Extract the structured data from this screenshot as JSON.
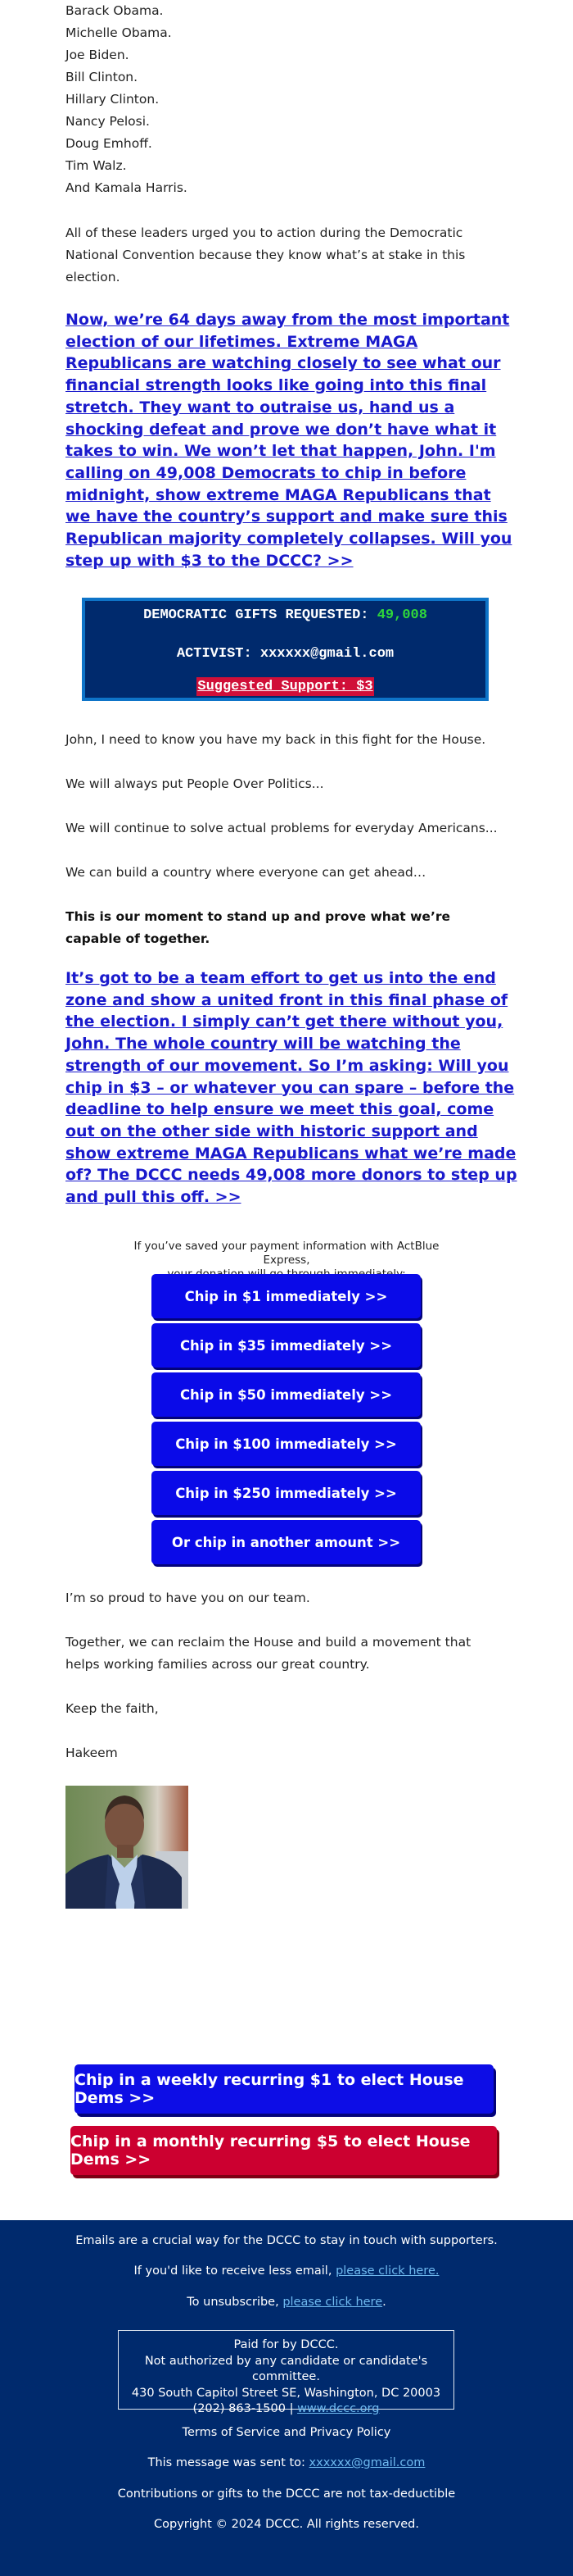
{
  "leaders": [
    "Barack Obama.",
    "Michelle Obama.",
    "Joe Biden.",
    "Bill Clinton.",
    "Hillary Clinton.",
    "Nancy Pelosi.",
    "Doug Emhoff.",
    "Tim Walz.",
    "And Kamala Harris."
  ],
  "intro_paragraph": "All of these leaders urged you to action during the Democratic National Convention because they know what’s at stake in this election.",
  "cta_link_1": "Now, we’re 64 days away from the most important election of our lifetimes. Extreme MAGA Republicans are watching closely to see what our financial strength looks like going into this final stretch. They want to outraise us, hand us a shocking defeat and prove we don’t have what it takes to win. We won’t let that happen, John. I'm calling on 49,008 Democrats to chip in before midnight, show extreme MAGA Republicans that we have the country’s support and make sure this Republican majority completely collapses. Will you step up with $3 to the DCCC? >>",
  "gift_box": {
    "requested_label": "DEMOCRATIC GIFTS REQUESTED: ",
    "requested_count": "49,008",
    "activist_label": "ACTIVIST: xxxxxx@gmail.com",
    "suggested_support": "Suggested Support: $3",
    "colors": {
      "background": "#002a6d",
      "border": "#0e74c8",
      "count": "#2fd73a",
      "support_bg": "#d00f38"
    }
  },
  "paragraphs": [
    "John, I need to know you have my back in this fight for the House.",
    "We will always put People Over Politics...",
    "We will continue to solve actual problems for everyday Americans...",
    "We can build a country where everyone can get ahead…"
  ],
  "bold_paragraph": "This is our moment to stand up and prove what we’re capable of together.",
  "cta_link_2": "It’s got to be a team effort to get us into the end zone and show a united front in this final phase of the election. I simply can’t get there without you, John. The whole country will be watching the strength of our movement. So I’m asking: Will you chip in $3 – or whatever you can spare – before the deadline to help ensure we meet this goal, come out on the other side with historic support and show extreme MAGA Republicans what we’re made of? The DCCC needs 49,008 more donors to step up and pull this off. >>",
  "express_note_line1": "If you’ve saved your payment information with ActBlue Express,",
  "express_note_line2": "your donation will go through immediately:",
  "chip_buttons": [
    "Chip in $1 immediately >>",
    "Chip in $35 immediately >>",
    "Chip in $50 immediately >>",
    "Chip in $100 immediately >>",
    "Chip in $250 immediately >>",
    "Or chip in another amount >>"
  ],
  "closing": {
    "proud": "I’m so proud to have you on our team.",
    "together": "Together, we can reclaim the House and build a movement that helps working families across our great country.",
    "signoff": "Keep the faith,",
    "signature": "Hakeem"
  },
  "photo_alt": "Portrait of Hakeem",
  "recurring": {
    "weekly": "Chip in a weekly recurring $1 to elect House Dems >>",
    "monthly": "Chip in a monthly recurring $5 to elect House Dems >>",
    "colors": {
      "weekly": "#0d0de6",
      "monthly": "#cc0030"
    }
  },
  "footer": {
    "emails_crucial": "Emails are a crucial way for the DCCC to stay in touch with supporters.",
    "less_email_prefix": "If you'd like to receive less email, ",
    "less_email_link": "please click here.",
    "unsubscribe_prefix": "To unsubscribe, ",
    "unsubscribe_link": "please click here",
    "unsubscribe_suffix": ".",
    "paid_for": "Paid for by DCCC.",
    "not_authorized": "Not authorized by any candidate or candidate's committee.",
    "address": "430 South Capitol Street SE, Washington, DC 20003",
    "phone": "(202) 863-1500 | ",
    "website": "www.dccc.org",
    "terms": "Terms of Service and Privacy Policy",
    "sent_to_prefix": "This message was sent to: ",
    "sent_to_email": "xxxxxx@gmail.com",
    "tax_note": "Contributions or gifts to the DCCC are not tax-deductible",
    "copyright": "Copyright © 2024 DCCC. All rights reserved.",
    "background": "#002a6d",
    "link_color": "#6fbaf0"
  }
}
